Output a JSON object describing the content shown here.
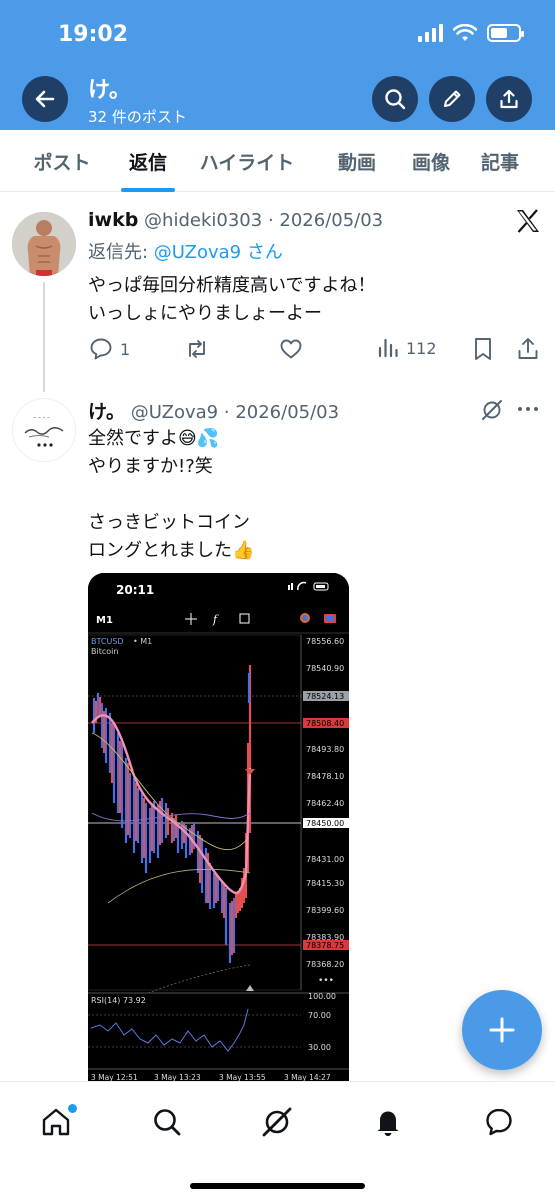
{
  "status": {
    "time": "19:02"
  },
  "header": {
    "title": "け。",
    "subtitle": "32 件のポスト"
  },
  "tabs": [
    {
      "label": "ポスト",
      "active": false
    },
    {
      "label": "返信",
      "active": true
    },
    {
      "label": "ハイライト",
      "active": false
    },
    {
      "label": "動画",
      "active": false
    },
    {
      "label": "画像",
      "active": false
    },
    {
      "label": "記事",
      "active": false
    }
  ],
  "post1": {
    "name": "iwkb",
    "handle": "@hideki0303",
    "date": "· 2026/05/03",
    "reply_prefix": "返信先: ",
    "reply_handle": "@UZova9 さん",
    "text": "やっぱ毎回分析精度高いですよね！\nいっしょにやりましょーよー",
    "replies": "1",
    "views": "112"
  },
  "post2": {
    "name": "け。",
    "handle": "@UZova9",
    "date": "· 2026/05/03",
    "text": "全然ですよ😅💦\nやりますか!?笑\n\nさっきビットコイン\nロングとれました👍"
  },
  "chart_screenshot": {
    "time": "20:11",
    "timeframe": "M1",
    "symbol": "BTCUSD",
    "symbol_tf": "• M1",
    "instrument": "Bitcoin",
    "price_labels": [
      "78556.60",
      "78540.90",
      "78524.13",
      "78508.40",
      "78493.80",
      "78478.10",
      "78462.40",
      "78450.00",
      "78431.00",
      "78415.30",
      "78399.60",
      "78383.90",
      "78378.75",
      "78368.20"
    ],
    "rsi_label": "RSI(14) 73.92",
    "rsi_levels": [
      "100.00",
      "70.00",
      "30.00"
    ],
    "time_labels": [
      "3 May 12:51",
      "3 May 13:23",
      "3 May 13:55",
      "3 May 14:27"
    ]
  }
}
